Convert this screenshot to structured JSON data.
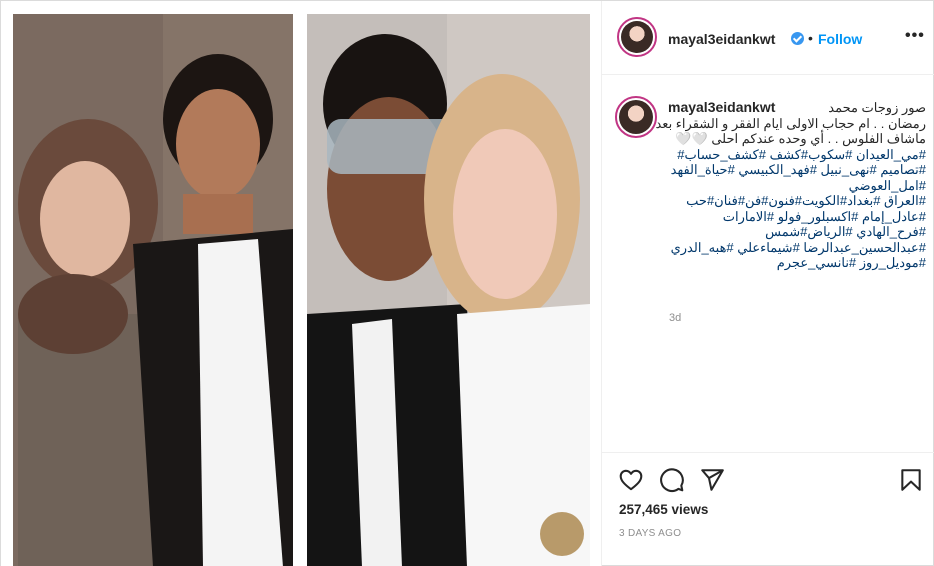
{
  "post": {
    "username": "mayal3eidankwt",
    "follow_label": "Follow",
    "separator": "•",
    "more_label": "•••"
  },
  "caption": {
    "username": "mayal3eidankwt",
    "lines": [
      "صور زوجات محمد",
      "رمضان . . ام حجاب الاولى ايام الفقر و الشقراء بعد",
      "ماشاف الفلوس . . أي وحده عندكم احلى 🤍🤍",
      "#مي_العيدان #سكوب#كشف #كشف_حساب#",
      "#تصاميم #نهى_نبيل #فهد_الكبيسي #حياة_الفهد",
      "#امل_العوضي",
      "#العراق #بغداد#الكويت#فنون#فن#فنان#حب",
      "#عادل_إمام #اكسبلور_فولو #الامارات",
      "#فرح_الهادي #الرياض#شمس",
      "#عبدالحسين_عبدالرضا #شيماءعلي #هبه_الدري",
      "#موديل_روز #نانسي_عجرم"
    ],
    "age": "3d"
  },
  "actions": {
    "like_icon": "heart-icon",
    "comment_icon": "comment-icon",
    "share_icon": "paper-plane-icon",
    "save_icon": "bookmark-icon"
  },
  "stats": {
    "views": "257,465 views",
    "date": "3 DAYS AGO"
  },
  "colors": {
    "link": "#0095f6",
    "hashtag": "#00376b",
    "muted": "#8e8e8e",
    "verified": "#3897f0",
    "story_ring": "#c13584"
  }
}
